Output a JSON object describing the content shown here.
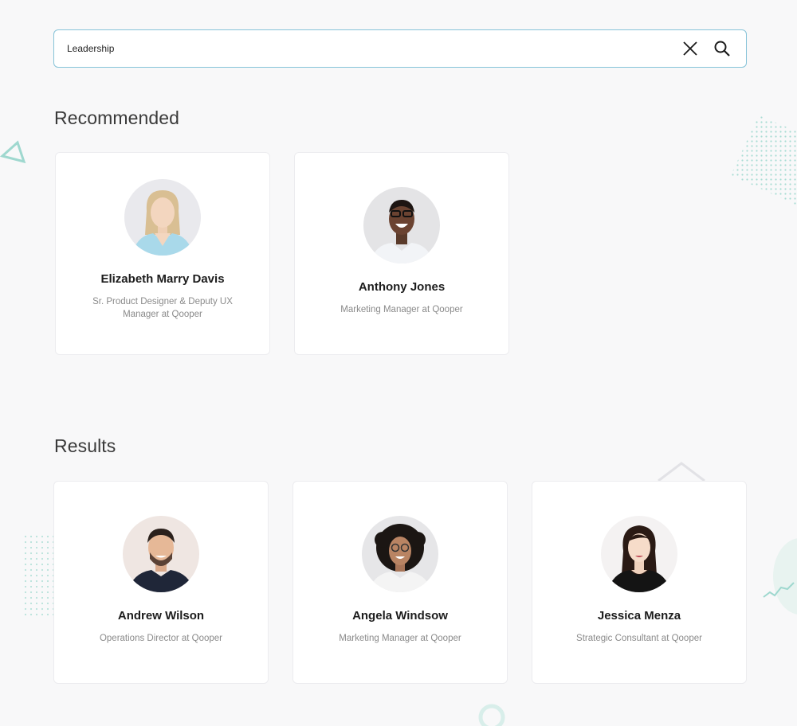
{
  "search": {
    "value": "Leadership",
    "clear_icon": "close-icon",
    "search_icon": "search-icon"
  },
  "sections": {
    "recommended_title": "Recommended",
    "results_title": "Results"
  },
  "recommended": [
    {
      "name": "Elizabeth Marry Davis",
      "role": "Sr. Product Designer & Deputy UX Manager at  Qooper"
    },
    {
      "name": "Anthony Jones",
      "role": "Marketing Manager at Qooper"
    }
  ],
  "results": [
    {
      "name": "Andrew Wilson",
      "role": "Operations Director at Qooper"
    },
    {
      "name": "Angela Windsow",
      "role": "Marketing Manager at Qooper"
    },
    {
      "name": "Jessica Menza",
      "role": "Strategic Consultant at Qooper"
    }
  ],
  "colors": {
    "background": "#f8f8f9",
    "search_border": "#86c3d8",
    "accent_deco": "#8ccfc4",
    "name_text": "#1c1c1c",
    "role_text": "#8a8a8a"
  }
}
